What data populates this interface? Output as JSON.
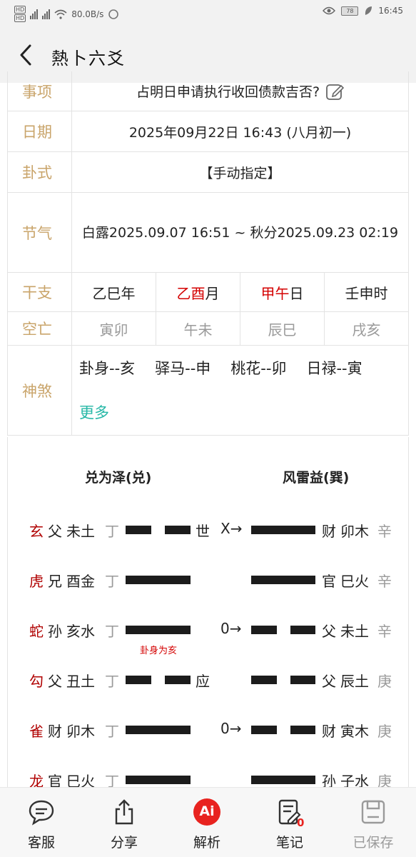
{
  "status_bar": {
    "net_speed": "80.0B/s",
    "battery": "78",
    "time": "16:45"
  },
  "header": {
    "title": "熱卜六爻"
  },
  "info": {
    "matter_label": "事项",
    "matter_value": "占明日申请执行收回债款吉否?",
    "date_label": "日期",
    "date_value": "2025年09月22日 16:43 (八月初一)",
    "gua_label": "卦式",
    "gua_value": "【手动指定】",
    "jieqi_label": "节气",
    "jieqi_value": "白露2025.09.07 16:51 ~ 秋分2025.09.23 02:19",
    "ganzhi_label": "干支",
    "ganzhi": [
      {
        "gan": "乙巳",
        "unit": "年"
      },
      {
        "gan": "乙酉",
        "unit": "月"
      },
      {
        "gan": "甲午",
        "unit": "日"
      },
      {
        "gan": "壬申",
        "unit": "时"
      }
    ],
    "kong_label": "空亡",
    "kong": [
      "寅卯",
      "午未",
      "辰巳",
      "戌亥"
    ],
    "shensha_label": "神煞",
    "shensha": [
      "卦身--亥",
      "驿马--申",
      "桃花--卯",
      "日禄--寅"
    ],
    "more_label": "更多"
  },
  "hexagram": {
    "main_name": "兑为泽(兑)",
    "changed_name": "风雷益(巽)",
    "lines": [
      {
        "beast": "玄",
        "relation": "父",
        "branch": "未土",
        "stem": "丁",
        "mark": "世",
        "change": "X→",
        "c_relation": "财",
        "c_branch": "卯木",
        "c_stem": "辛"
      },
      {
        "beast": "虎",
        "relation": "兄",
        "branch": "酉金",
        "stem": "丁",
        "mark": "",
        "change": "",
        "c_relation": "官",
        "c_branch": "巳火",
        "c_stem": "辛"
      },
      {
        "beast": "蛇",
        "relation": "孙",
        "branch": "亥水",
        "stem": "丁",
        "mark": "",
        "change": "0→",
        "c_relation": "父",
        "c_branch": "未土",
        "c_stem": "辛"
      },
      {
        "beast": "勾",
        "relation": "父",
        "branch": "丑土",
        "stem": "丁",
        "mark": "应",
        "change": "",
        "c_relation": "父",
        "c_branch": "辰土",
        "c_stem": "庚"
      },
      {
        "beast": "雀",
        "relation": "财",
        "branch": "卯木",
        "stem": "丁",
        "mark": "",
        "change": "0→",
        "c_relation": "财",
        "c_branch": "寅木",
        "c_stem": "庚"
      },
      {
        "beast": "龙",
        "relation": "官",
        "branch": "巳火",
        "stem": "丁",
        "mark": "",
        "change": "",
        "c_relation": "孙",
        "c_branch": "子水",
        "c_stem": "庚"
      }
    ],
    "body_note": "卦身为亥"
  },
  "bottom_bar": {
    "service": "客服",
    "share": "分享",
    "analysis": "解析",
    "ai_badge": "Ai",
    "notes": "笔记",
    "notes_count": "0",
    "saved": "已保存"
  },
  "colors": {
    "label_gold": "#c9a46a",
    "red": "#d40000",
    "teal": "#25b7a6",
    "ai_red": "#e8231f"
  }
}
